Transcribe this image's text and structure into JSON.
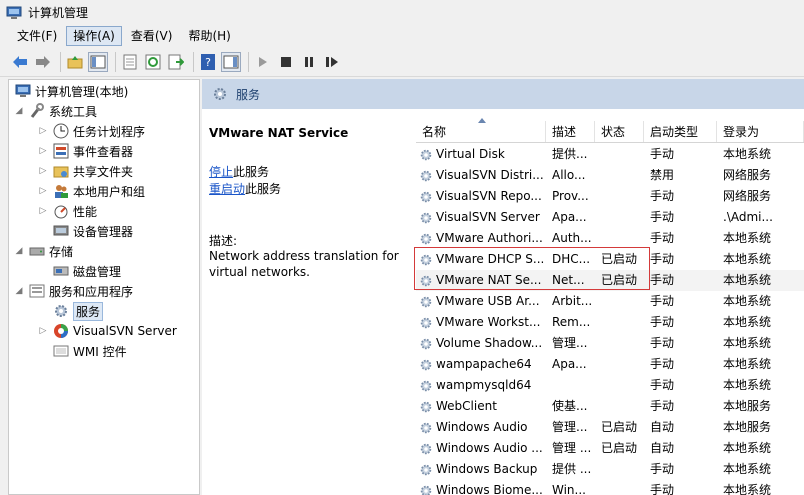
{
  "window": {
    "title": "计算机管理"
  },
  "menu": {
    "items": [
      "文件(F)",
      "操作(A)",
      "查看(V)",
      "帮助(H)"
    ]
  },
  "tree": {
    "root": "计算机管理(本地)",
    "system_tools": "系统工具",
    "task_scheduler": "任务计划程序",
    "event_viewer": "事件查看器",
    "shared_folders": "共享文件夹",
    "local_users": "本地用户和组",
    "performance": "性能",
    "device_manager": "设备管理器",
    "storage": "存储",
    "disk_mgmt": "磁盘管理",
    "services_apps": "服务和应用程序",
    "services": "服务",
    "visualsvn": "VisualSVN Server",
    "wmi": "WMI 控件"
  },
  "header": {
    "title": "服务"
  },
  "details": {
    "name": "VMware NAT Service",
    "stop_link": "停止",
    "stop_suffix": "此服务",
    "restart_link": "重启动",
    "restart_suffix": "此服务",
    "desc_label": "描述:",
    "desc_text": "Network address translation for virtual networks."
  },
  "columns": {
    "name": "名称",
    "desc": "描述",
    "status": "状态",
    "startup": "启动类型",
    "logon": "登录为"
  },
  "rows": [
    {
      "name": "Virtual Disk",
      "desc": "提供...",
      "status": "",
      "startup": "手动",
      "logon": "本地系统"
    },
    {
      "name": "VisualSVN Distri...",
      "desc": "Allo...",
      "status": "",
      "startup": "禁用",
      "logon": "网络服务"
    },
    {
      "name": "VisualSVN Repo...",
      "desc": "Prov...",
      "status": "",
      "startup": "手动",
      "logon": "网络服务"
    },
    {
      "name": "VisualSVN Server",
      "desc": "Apa...",
      "status": "",
      "startup": "手动",
      "logon": ".\\Admi..."
    },
    {
      "name": "VMware Authori...",
      "desc": "Auth...",
      "status": "",
      "startup": "手动",
      "logon": "本地系统"
    },
    {
      "name": "VMware DHCP S...",
      "desc": "DHC...",
      "status": "已启动",
      "startup": "手动",
      "logon": "本地系统"
    },
    {
      "name": "VMware NAT Se...",
      "desc": "Net...",
      "status": "已启动",
      "startup": "手动",
      "logon": "本地系统"
    },
    {
      "name": "VMware USB Ar...",
      "desc": "Arbit...",
      "status": "",
      "startup": "手动",
      "logon": "本地系统"
    },
    {
      "name": "VMware Workst...",
      "desc": "Rem...",
      "status": "",
      "startup": "手动",
      "logon": "本地系统"
    },
    {
      "name": "Volume Shadow...",
      "desc": "管理...",
      "status": "",
      "startup": "手动",
      "logon": "本地系统"
    },
    {
      "name": "wampapache64",
      "desc": "Apa...",
      "status": "",
      "startup": "手动",
      "logon": "本地系统"
    },
    {
      "name": "wampmysqld64",
      "desc": "",
      "status": "",
      "startup": "手动",
      "logon": "本地系统"
    },
    {
      "name": "WebClient",
      "desc": "使基...",
      "status": "",
      "startup": "手动",
      "logon": "本地服务"
    },
    {
      "name": "Windows Audio",
      "desc": "管理...",
      "status": "已启动",
      "startup": "自动",
      "logon": "本地服务"
    },
    {
      "name": "Windows Audio ...",
      "desc": "管理 ...",
      "status": "已启动",
      "startup": "自动",
      "logon": "本地系统"
    },
    {
      "name": "Windows Backup",
      "desc": "提供 ...",
      "status": "",
      "startup": "手动",
      "logon": "本地系统"
    },
    {
      "name": "Windows Biome...",
      "desc": "Win...",
      "status": "",
      "startup": "手动",
      "logon": "本地系统"
    }
  ],
  "colors": {
    "header_band": "#c8d6e8",
    "highlight_box": "#d43a3a",
    "link": "#1a55c8"
  }
}
